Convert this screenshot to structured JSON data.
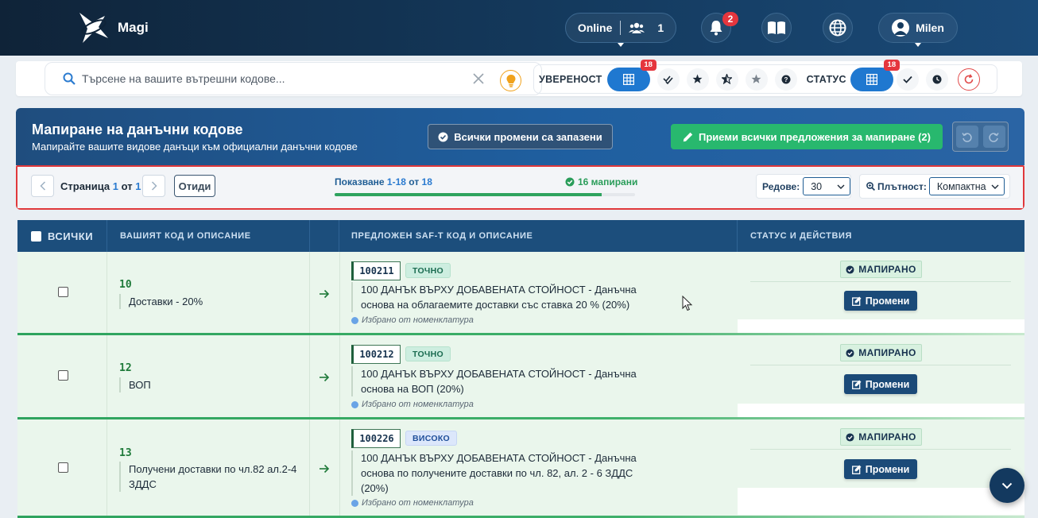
{
  "nav": {
    "brand": "Magi",
    "online_label": "Online",
    "online_count": "1",
    "notifications_count": "2",
    "user_name": "Milen"
  },
  "search": {
    "placeholder": "Търсене на вашите вътрешни кодове...",
    "value": ""
  },
  "filters": {
    "confidence_label": "УВЕРЕНОСТ",
    "confidence_badge": "18",
    "status_label": "СТАТУС",
    "status_badge": "18"
  },
  "panel": {
    "title": "Мапиране на данъчни кодове",
    "subtitle": "Мапирайте вашите видове данъци към официални данъчни кодове",
    "saved_label": "Всички промени са запазени",
    "accept_label": "Приеми всички предложения за мапиране (2)"
  },
  "pager": {
    "page_word": "Страница",
    "current": "1",
    "of_word": "от",
    "total": "1",
    "goto_label": "Отиди",
    "showing_word": "Показване",
    "range": "1-18",
    "showing_of": "от",
    "total_items": "18",
    "mapped_label": "16 мапирани",
    "progress_fraction": 0.89,
    "rows_label": "Редове:",
    "rows_value": "30",
    "density_label": "Плътност:",
    "density_value": "Компактна"
  },
  "table": {
    "headers": {
      "all": "ВСИЧКИ",
      "your_code": "ВАШИЯТ КОД И ОПИСАНИЕ",
      "suggested": "ПРЕДЛОЖЕН SAF-T КОД И ОПИСАНИЕ",
      "status": "СТАТУС И ДЕЙСТВИЯ"
    },
    "rows": [
      {
        "code": "10",
        "description": "Доставки - 20%",
        "saf_code": "100211",
        "confidence": "ТОЧНО",
        "saf_description": "100 ДАНЪК ВЪРХУ ДОБАВЕНАТА СТОЙНОСТ - Данъчна основа на облагаемите доставки със ставка 20 % (20%)",
        "source": "Избрано от номенклатура",
        "status": "МАПИРАНО",
        "edit_label": "Промени"
      },
      {
        "code": "12",
        "description": "ВОП",
        "saf_code": "100212",
        "confidence": "ТОЧНО",
        "saf_description": "100 ДАНЪК ВЪРХУ ДОБАВЕНАТА СТОЙНОСТ - Данъчна основа на ВОП (20%)",
        "source": "Избрано от номенклатура",
        "status": "МАПИРАНО",
        "edit_label": "Промени"
      },
      {
        "code": "13",
        "description": "Получени доставки по чл.82 ал.2-4 ЗДДС",
        "saf_code": "100226",
        "confidence": "ВИСОКО",
        "saf_description": "100 ДАНЪК ВЪРХУ ДОБАВЕНАТА СТОЙНОСТ - Данъчна основа по получените доставки по чл. 82, ал. 2 - 6 ЗДДС (20%)",
        "source": "Избрано от номенклатура",
        "status": "МАПИРАНО",
        "edit_label": "Промени"
      }
    ]
  },
  "colors": {
    "nav_bg": "#0f2338",
    "accent_blue": "#1f78d0",
    "accept_green": "#28b86e",
    "mapped_green": "#2ea35e",
    "badge_red": "#e5363e",
    "table_header": "#1c4e7c"
  },
  "icons": [
    "magi-logo-icon",
    "users-icon",
    "bell-icon",
    "book-icon",
    "globe-icon",
    "user-avatar-icon",
    "search-icon",
    "clear-icon",
    "lightbulb-icon",
    "grid-icon",
    "double-check-icon",
    "star-icon",
    "half-star-icon",
    "star-outline-icon",
    "question-icon",
    "check-icon",
    "clock-icon",
    "refresh-icon",
    "check-circle-icon",
    "pencil-icon",
    "undo-icon",
    "redo-icon",
    "chevron-left-icon",
    "chevron-right-icon",
    "zoom-icon",
    "arrow-right-icon",
    "info-icon",
    "edit-icon",
    "chevron-down-icon"
  ]
}
